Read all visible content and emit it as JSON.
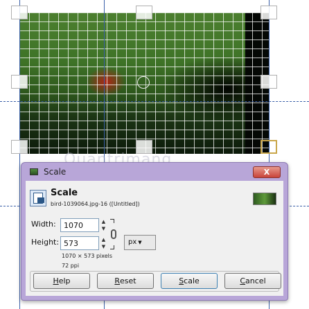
{
  "dialog": {
    "title": "Scale",
    "close_label": "X",
    "header": {
      "title": "Scale",
      "subtitle": "bird-1039064.jpg-16 ([Untitled])"
    },
    "width": {
      "label": "Width:",
      "value": "1070"
    },
    "height": {
      "label": "Height:",
      "value": "573"
    },
    "unit": "px",
    "info_size": "1070 × 573 pixels",
    "info_res": "72 ppi",
    "buttons": {
      "help_pre": "",
      "help_u": "H",
      "help_post": "elp",
      "reset_pre": "",
      "reset_u": "R",
      "reset_post": "eset",
      "scale_pre": "",
      "scale_u": "S",
      "scale_post": "cale",
      "cancel_pre": "",
      "cancel_u": "C",
      "cancel_post": "ancel"
    }
  },
  "watermark": "Quantrimang",
  "icons": {
    "title": "image-icon",
    "header": "scale-icon",
    "chain": "chain-link-icon",
    "spin_up": "arrow-up-icon",
    "spin_down": "arrow-down-icon"
  }
}
